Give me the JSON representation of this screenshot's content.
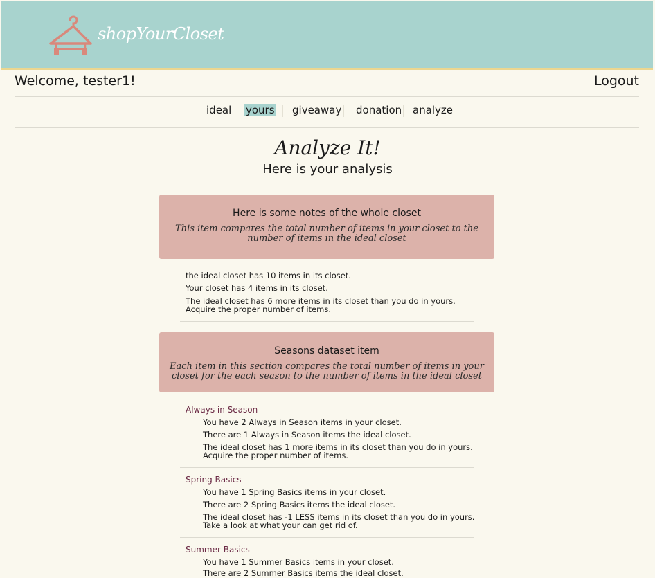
{
  "header": {
    "brand": "shopYourCloset",
    "colors": {
      "header_bg": "#a8d3ce",
      "accent_line": "#ecd68f",
      "hanger": "#d9887b",
      "panel_bg": "#dcb2aa",
      "category_text": "#6b2a45"
    }
  },
  "user": {
    "welcome": "Welcome, tester1!",
    "logout_label": "Logout"
  },
  "nav": {
    "items": [
      "ideal",
      "yours",
      "giveaway",
      "donation",
      "analyze"
    ],
    "active": "yours"
  },
  "page": {
    "title": "Analyze It!",
    "subtitle": "Here is your analysis"
  },
  "whole_closet": {
    "title": "Here is some notes of the whole closet",
    "description": "This item compares the total number of items in your closet to the number of items in the ideal closet",
    "lines": [
      "the ideal closet has 10 items in its closet.",
      "Your closet has 4 items in its closet.",
      "The ideal closet has 6 more items in its closet than you do in yours.",
      "Acquire the proper number of items."
    ]
  },
  "seasons": {
    "title": "Seasons dataset item",
    "description": "Each item in this section compares the total number of items in your closet for the each season to the number of items in the ideal closet",
    "categories": [
      {
        "name": "Always in Season",
        "lines": [
          "You have 2 Always in Season items in your closet.",
          "There are 1 Always in Season items the ideal closet.",
          "The ideal closet has 1 more items in its closet than you do in yours.",
          "Acquire the proper number of items."
        ]
      },
      {
        "name": "Spring Basics",
        "lines": [
          "You have 1 Spring Basics items in your closet.",
          "There are 2 Spring Basics items the ideal closet.",
          "The ideal closet has -1 LESS items in its closet than you do in yours.",
          "Take a look at what your can get rid of."
        ]
      },
      {
        "name": "Summer Basics",
        "lines": [
          "You have 1 Summer Basics items in your closet.",
          "There are 2 Summer Basics items the ideal closet."
        ]
      }
    ]
  }
}
